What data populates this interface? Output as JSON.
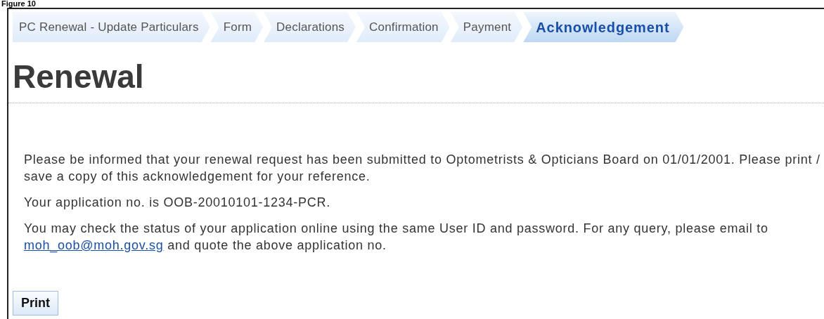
{
  "caption": "Figure 10",
  "steps": [
    {
      "label": "PC Renewal - Update Particulars",
      "selected": false
    },
    {
      "label": "Form",
      "selected": false
    },
    {
      "label": "Declarations",
      "selected": false
    },
    {
      "label": "Confirmation",
      "selected": false
    },
    {
      "label": "Payment",
      "selected": false
    },
    {
      "label": "Acknowledgement",
      "selected": true
    }
  ],
  "heading": "Renewal",
  "paragraphs": [
    {
      "text": "Please be informed that your renewal request has been submitted to Optometrists & Opticians Board on 01/01/2001. Please print / save a copy of this acknowledgement for your reference."
    },
    {
      "text": "Your application no. is OOB-20010101-1234-PCR."
    },
    {
      "text": "You may check the status of your application online using the same User ID and password. For any query, please email to",
      "link": "moh_oob@moh.gov.sg",
      "after": "and quote the above application no."
    }
  ],
  "buttons": [
    "Print"
  ]
}
